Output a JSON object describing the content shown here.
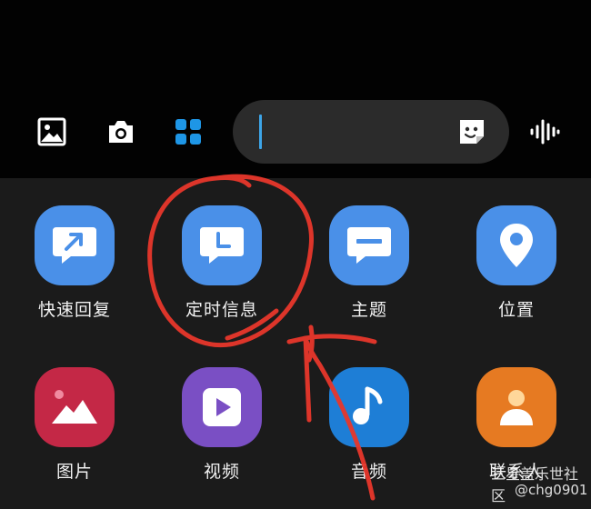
{
  "toolbar": {
    "items": [
      {
        "icon": "gallery-icon"
      },
      {
        "icon": "camera-icon"
      },
      {
        "icon": "apps-grid-icon",
        "color": "#1e96e6"
      }
    ],
    "input": {
      "value": "",
      "cursor_color": "#3da5e8",
      "sticker_icon": "sticker-icon"
    },
    "voice_icon": "voice-wave-icon"
  },
  "apps": [
    {
      "label": "快速回复",
      "icon": "quick-reply-icon",
      "color": "#4a90e8"
    },
    {
      "label": "定时信息",
      "icon": "scheduled-message-icon",
      "color": "#4a90e8"
    },
    {
      "label": "主题",
      "icon": "subject-icon",
      "color": "#4a90e8"
    },
    {
      "label": "位置",
      "icon": "location-icon",
      "color": "#4a90e8"
    },
    {
      "label": "图片",
      "icon": "image-icon",
      "color": "#c42846"
    },
    {
      "label": "视频",
      "icon": "video-icon",
      "color": "#7a4fc4"
    },
    {
      "label": "音频",
      "icon": "audio-icon",
      "color": "#1e7ed6"
    },
    {
      "label": "联系人",
      "icon": "contact-icon",
      "color": "#e67a22"
    }
  ],
  "watermark": {
    "line1": "三星盖乐世社区",
    "line2": "@chg0901"
  },
  "annotation_color": "#e8372b"
}
